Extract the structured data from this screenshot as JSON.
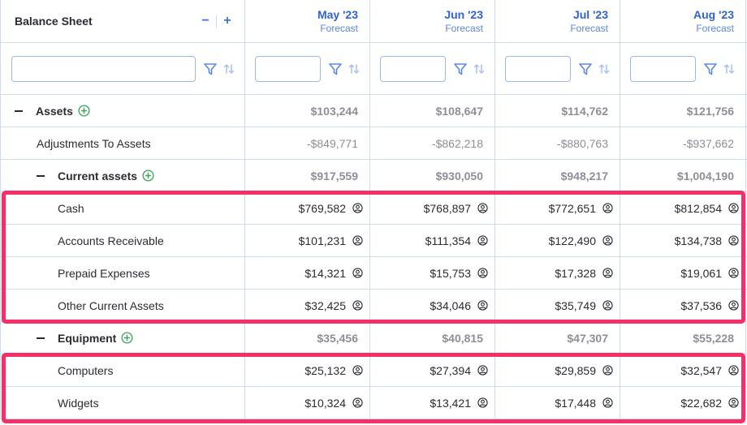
{
  "header": {
    "title": "Balance Sheet",
    "collapse_all_label": "−",
    "expand_all_label": "+",
    "columns": [
      {
        "month": "May '23",
        "type": "Forecast"
      },
      {
        "month": "Jun '23",
        "type": "Forecast"
      },
      {
        "month": "Jul '23",
        "type": "Forecast"
      },
      {
        "month": "Aug '23",
        "type": "Forecast"
      }
    ]
  },
  "filters": {
    "name_filter_value": "",
    "column_filter_values": [
      "",
      "",
      "",
      ""
    ],
    "filter_icon": "filter-icon",
    "sort_icon": "sort-icon"
  },
  "rows": [
    {
      "label": "Assets",
      "kind": "group",
      "values": [
        "$103,244",
        "$108,647",
        "$114,762",
        "$121,756"
      ]
    },
    {
      "label": "Adjustments To Assets",
      "kind": "adjustment",
      "values": [
        "-$849,771",
        "-$862,218",
        "-$880,763",
        "-$937,662"
      ]
    },
    {
      "label": "Current assets",
      "kind": "subgroup",
      "values": [
        "$917,559",
        "$930,050",
        "$948,217",
        "$1,004,190"
      ]
    },
    {
      "label": "Cash",
      "kind": "item",
      "values": [
        "$769,582",
        "$768,897",
        "$772,651",
        "$812,854"
      ]
    },
    {
      "label": "Accounts Receivable",
      "kind": "item",
      "values": [
        "$101,231",
        "$111,354",
        "$122,490",
        "$134,738"
      ]
    },
    {
      "label": "Prepaid Expenses",
      "kind": "item",
      "values": [
        "$14,321",
        "$15,753",
        "$17,328",
        "$19,061"
      ]
    },
    {
      "label": "Other Current Assets",
      "kind": "item",
      "values": [
        "$32,425",
        "$34,046",
        "$35,749",
        "$37,536"
      ]
    },
    {
      "label": "Equipment",
      "kind": "subgroup",
      "values": [
        "$35,456",
        "$40,815",
        "$47,307",
        "$55,228"
      ]
    },
    {
      "label": "Computers",
      "kind": "item",
      "values": [
        "$25,132",
        "$27,394",
        "$29,859",
        "$32,547"
      ]
    },
    {
      "label": "Widgets",
      "kind": "item",
      "values": [
        "$10,324",
        "$13,421",
        "$17,448",
        "$22,682"
      ]
    }
  ],
  "colors": {
    "accent": "#2f63d8",
    "highlight": "#f72f68",
    "add_icon": "#3aa65a",
    "grid_line": "#cfdcf0"
  }
}
